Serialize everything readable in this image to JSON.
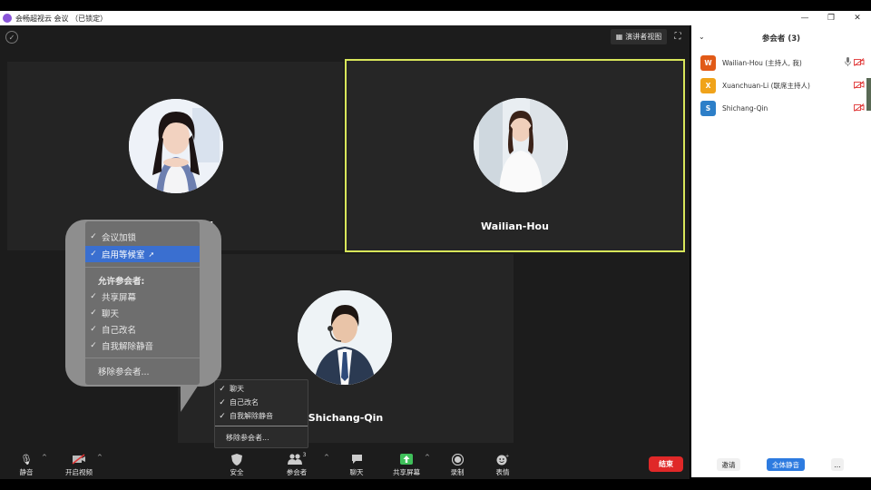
{
  "window": {
    "title": "会畅超视云 会议 （已锁定）",
    "minimize": "—",
    "maximize": "❐",
    "close": "✕"
  },
  "view": {
    "speaker_view_label": "演讲者视图",
    "fullscreen_icon": "fullscreen-icon"
  },
  "tiles": [
    {
      "name": "Xuanchuan-Li"
    },
    {
      "name": "Wailian-Hou"
    },
    {
      "name": "Shichang-Qin"
    }
  ],
  "security_menu": {
    "items": [
      {
        "label": "会议加锁",
        "checked": true
      },
      {
        "label": "启用等候室",
        "checked": true,
        "highlighted": true
      }
    ],
    "allow_header": "允许参会者:",
    "allow_items": [
      {
        "label": "共享屏幕",
        "checked": true
      },
      {
        "label": "聊天",
        "checked": true
      },
      {
        "label": "自己改名",
        "checked": true
      },
      {
        "label": "自我解除静音",
        "checked": true
      }
    ],
    "remove_label": "移除参会者..."
  },
  "security_menu_small": {
    "items": [
      {
        "label": "聊天",
        "checked": true
      },
      {
        "label": "自己改名",
        "checked": true
      },
      {
        "label": "自我解除静音",
        "checked": true
      }
    ],
    "remove_label": "移除参会者..."
  },
  "toolbar": {
    "mute": "静音",
    "start_video": "开启视频",
    "security": "安全",
    "participants": "参会者",
    "participants_count": "3",
    "chat": "聊天",
    "share_screen": "共享屏幕",
    "record": "录制",
    "reactions": "表情",
    "end": "结束",
    "share_color": "#3fc05a",
    "end_color": "#e02828"
  },
  "panel": {
    "title": "参会者 (3)",
    "participants": [
      {
        "initial": "W",
        "name": "Wailian-Hou (主持人, 我)",
        "color": "#e15a17",
        "mic_icon": "mic-icon",
        "cam_icon": "video-off-icon"
      },
      {
        "initial": "X",
        "name": "Xuanchuan-Li (联席主持人)",
        "color": "#f0a31a",
        "cam_icon": "video-off-icon"
      },
      {
        "initial": "S",
        "name": "Shichang-Qin",
        "color": "#2d7fc8",
        "cam_icon": "video-off-icon"
      }
    ],
    "invite": "邀请",
    "mute_all": "全体静音",
    "more": "..."
  }
}
